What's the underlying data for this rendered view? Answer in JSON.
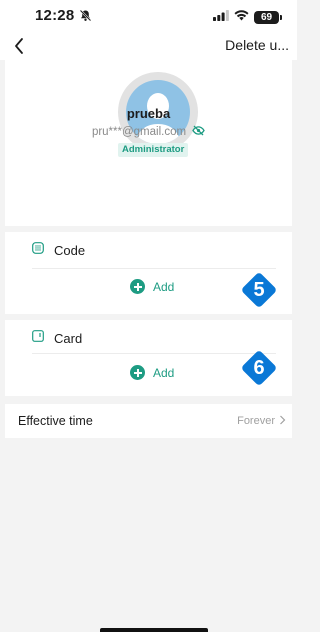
{
  "status_bar": {
    "time": "12:28",
    "battery": "69"
  },
  "nav": {
    "delete_label": "Delete u..."
  },
  "profile": {
    "name": "prueba",
    "email": "pru***@gmail.com",
    "role": "Administrator"
  },
  "sections": [
    {
      "title": "Code",
      "add_label": "Add",
      "step": "5"
    },
    {
      "title": "Card",
      "add_label": "Add",
      "step": "6"
    }
  ],
  "effective_time": {
    "label": "Effective time",
    "value": "Forever"
  },
  "colors": {
    "accent": "#1e9c83",
    "badge_blue": "#0a78d6"
  }
}
